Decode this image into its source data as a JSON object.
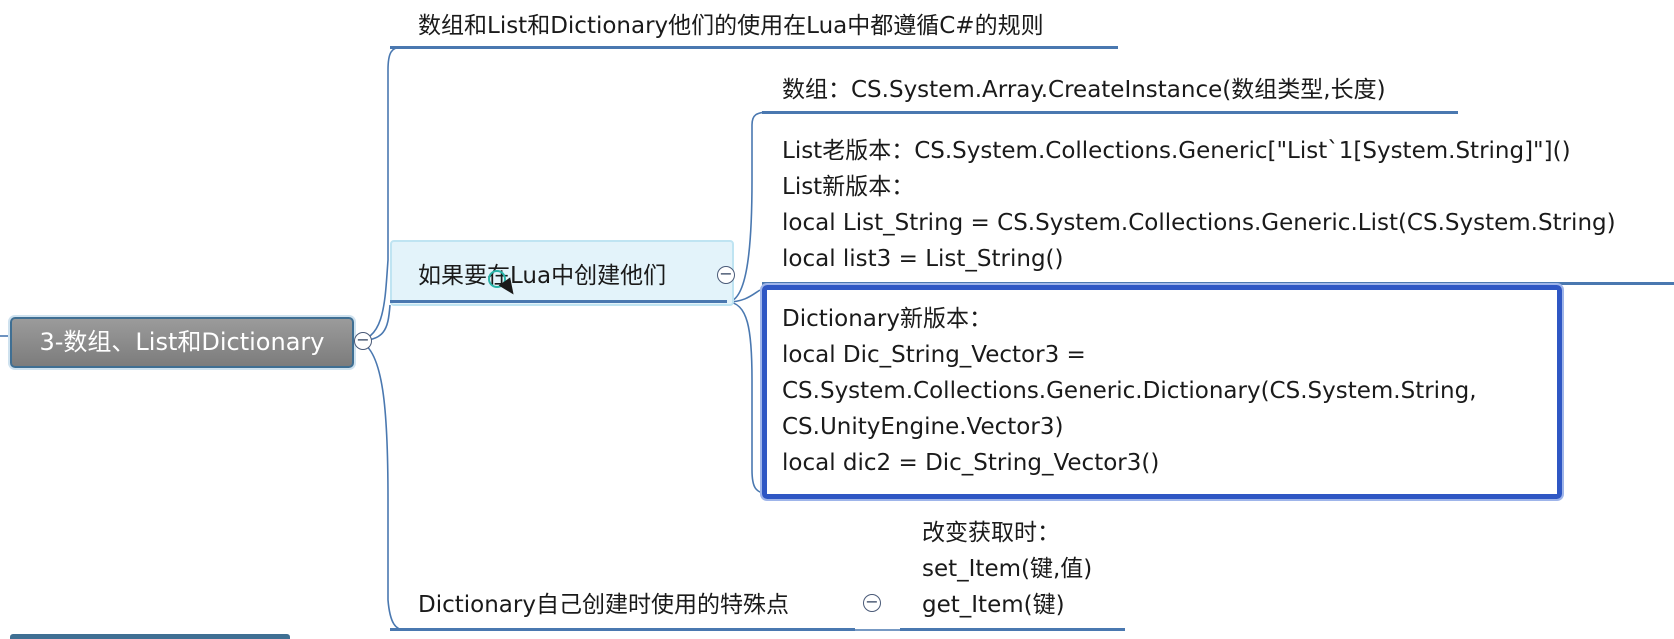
{
  "root_topic": {
    "label": "3-数组、List和Dictionary"
  },
  "topics": {
    "rule": {
      "label": "数组和List和Dictionary他们的使用在Lua中都遵循C#的规则"
    },
    "create": {
      "label": "如果要在Lua中创建他们"
    },
    "dict_special": {
      "label": "Dictionary自己创建时使用的特殊点"
    }
  },
  "create_children": {
    "array": {
      "label": "数组：CS.System.Array.CreateInstance(数组类型,长度)"
    },
    "list": {
      "lines": [
        "List老版本：CS.System.Collections.Generic[\"List`1[System.String]\"]()",
        "List新版本：",
        "local List_String = CS.System.Collections.Generic.List(CS.System.String)",
        "local list3 = List_String()"
      ]
    },
    "dictionary": {
      "lines": [
        "Dictionary新版本：",
        "local Dic_String_Vector3 =",
        "CS.System.Collections.Generic.Dictionary(CS.System.String,",
        "CS.UnityEngine.Vector3)",
        "local dic2 = Dic_String_Vector3()"
      ]
    }
  },
  "dict_special_children": {
    "lines": [
      "改变获取时：",
      "set_Item(键,值)",
      "get_Item(键)"
    ]
  },
  "collapse_symbol": "−",
  "colors": {
    "branch_line": "#4a78b0",
    "root_fill": "#8a8a8a",
    "selection_fill": "#e3f3fa",
    "focus_border": "#2f57c4"
  }
}
